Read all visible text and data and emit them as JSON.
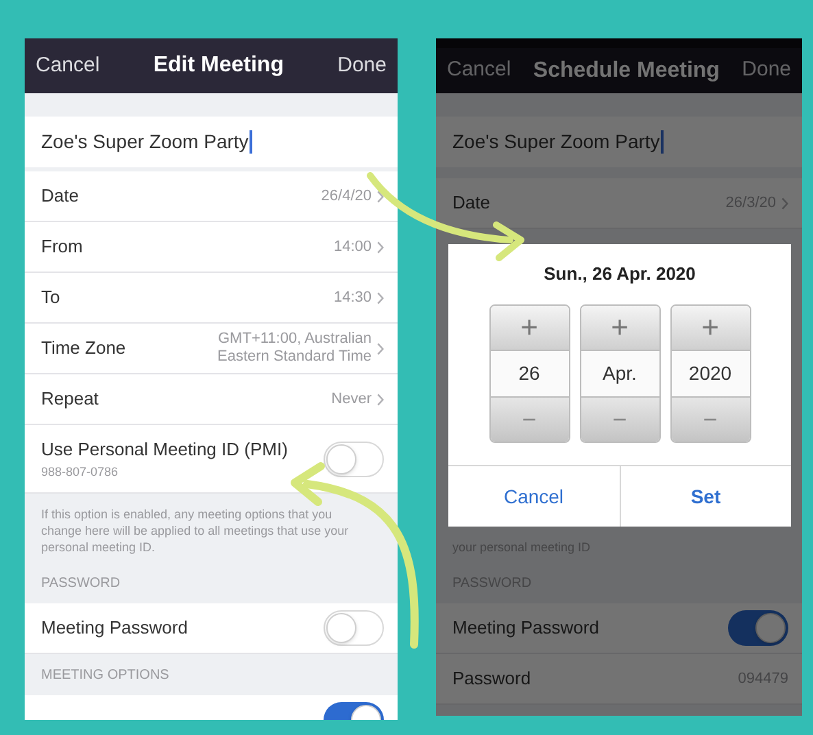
{
  "left_screen": {
    "header": {
      "cancel": "Cancel",
      "title": "Edit Meeting",
      "done": "Done"
    },
    "topic": "Zoe's Super Zoom Party",
    "rows": [
      {
        "kind": "link",
        "label": "Date",
        "value": "26/4/20"
      },
      {
        "kind": "link",
        "label": "From",
        "value": "14:00"
      },
      {
        "kind": "link",
        "label": "To",
        "value": "14:30"
      },
      {
        "kind": "link",
        "label": "Time Zone",
        "value": "GMT+11:00, Australian Eastern Standard Time"
      },
      {
        "kind": "link",
        "label": "Repeat",
        "value": "Never"
      },
      {
        "kind": "toggle",
        "label": "Use Personal Meeting ID (PMI)",
        "sublabel": "988-807-0786",
        "on": false
      },
      {
        "kind": "note",
        "text": "If this option is enabled, any meeting options that you change here will be applied to all meetings that use your personal meeting ID."
      },
      {
        "kind": "section",
        "text": "PASSWORD"
      },
      {
        "kind": "toggle",
        "label": "Meeting Password",
        "on": false
      },
      {
        "kind": "section",
        "text": "MEETING OPTIONS"
      },
      {
        "kind": "toggle",
        "on": true
      }
    ]
  },
  "right_screen": {
    "header": {
      "cancel": "Cancel",
      "title": "Schedule Meeting",
      "done": "Done"
    },
    "topic": "Zoe's Super Zoom Party",
    "rows": [
      {
        "kind": "link",
        "label": "Date",
        "value": "26/3/20"
      },
      {
        "kind": "note",
        "text": "your personal meeting ID"
      },
      {
        "kind": "section",
        "text": "PASSWORD"
      },
      {
        "kind": "toggle",
        "label": "Meeting Password",
        "on": true
      },
      {
        "kind": "value",
        "label": "Password",
        "value": "094479"
      }
    ],
    "dialog": {
      "title": "Sun., 26 Apr. 2020",
      "spinners": [
        {
          "plus": "+",
          "value": "26",
          "minus": "−"
        },
        {
          "plus": "+",
          "value": "Apr.",
          "minus": "−"
        },
        {
          "plus": "+",
          "value": "2020",
          "minus": "−"
        }
      ],
      "buttons": [
        {
          "kind": "cancel",
          "label": "Cancel"
        },
        {
          "kind": "confirm",
          "label": "Set"
        }
      ]
    }
  }
}
